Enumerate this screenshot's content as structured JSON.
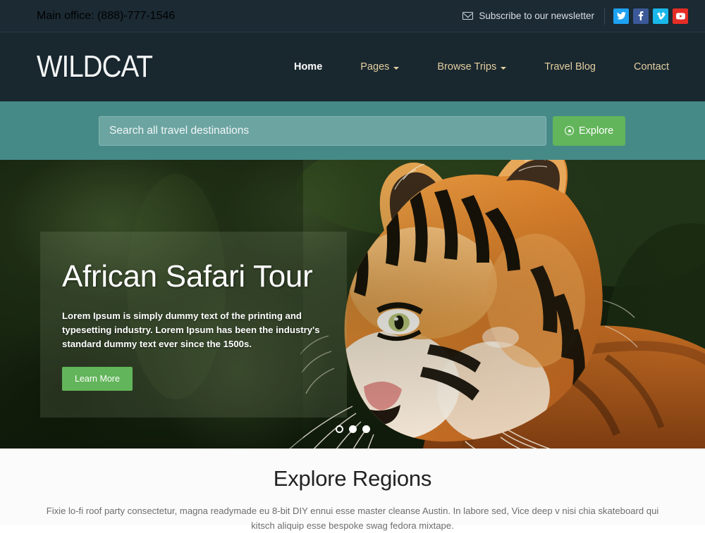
{
  "topbar": {
    "phone": "Main office: (888)-777-1546",
    "newsletter_label": "Subscribe to our newsletter",
    "mail_icon": "envelope-icon",
    "socials": [
      {
        "name": "twitter",
        "glyph": "t",
        "color": "#1da1f2"
      },
      {
        "name": "facebook",
        "glyph": "f",
        "color": "#3b5998"
      },
      {
        "name": "vimeo",
        "glyph": "v",
        "color": "#1ab7ea"
      },
      {
        "name": "youtube",
        "glyph": "y",
        "color": "#e52d27"
      }
    ]
  },
  "header": {
    "logo": "WILDCAT",
    "nav": [
      {
        "label": "Home",
        "active": true,
        "caret": false
      },
      {
        "label": "Pages",
        "active": false,
        "caret": true
      },
      {
        "label": "Browse Trips",
        "active": false,
        "caret": true
      },
      {
        "label": "Travel Blog",
        "active": false,
        "caret": false
      },
      {
        "label": "Contact",
        "active": false,
        "caret": false
      }
    ]
  },
  "search": {
    "placeholder": "Search all travel destinations",
    "value": "",
    "button_label": "Explore",
    "button_icon": "target-icon",
    "band_color": "#468a88",
    "button_color": "#62b55a"
  },
  "hero": {
    "image_subject": "close-up portrait of a tiger facing left against a blurred dark green jungle background",
    "title": "African Safari Tour",
    "body": "Lorem Ipsum is simply dummy text of the printing and typesetting industry. Lorem Ipsum has been the industry's standard dummy text ever since the 1500s.",
    "cta_label": "Learn More",
    "slides_total": 3,
    "slide_current": 1
  },
  "explore": {
    "title": "Explore Regions",
    "body": "Fixie lo-fi roof party consectetur, magna readymade eu 8-bit DIY ennui esse master cleanse Austin. In labore sed, Vice deep v nisi chia skateboard qui kitsch aliquip esse bespoke swag fedora mixtape."
  },
  "colors": {
    "topbar_bg": "#1b2a33",
    "header_bg": "#19272f",
    "nav_link": "#e3cfa0",
    "accent_green": "#62b55a",
    "teal": "#468a88"
  }
}
